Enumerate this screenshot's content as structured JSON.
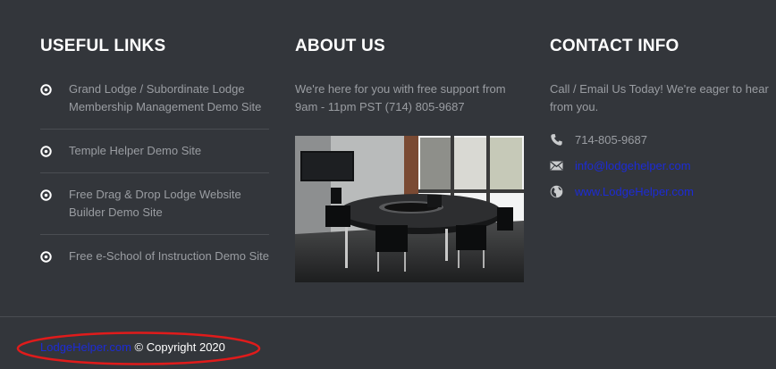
{
  "useful_links": {
    "heading": "USEFUL LINKS",
    "items": [
      {
        "label": "Grand Lodge / Subordinate Lodge Membership Management Demo Site"
      },
      {
        "label": "Temple Helper Demo Site"
      },
      {
        "label": "Free Drag & Drop Lodge Website Builder Demo Site"
      },
      {
        "label": "Free e-School of Instruction Demo Site"
      }
    ],
    "bullet_icon": "circle-dot-icon"
  },
  "about": {
    "heading": "ABOUT US",
    "text": "We're here for you with free support from 9am - 11pm PST (714) 805-9687",
    "photo": "conference-room-photo"
  },
  "contact": {
    "heading": "CONTACT INFO",
    "text": "Call / Email Us Today! We're eager to hear from you.",
    "phone": "714-805-9687",
    "email": "info@lodgehelper.com",
    "website": "www.LodgeHelper.com",
    "icons": {
      "phone": "phone-icon",
      "email": "envelope-icon",
      "website": "globe-icon"
    }
  },
  "bottom": {
    "site_link": "LodgeHelper.com",
    "copyright": "© Copyright 2020",
    "annotation": "red-ellipse-highlight"
  },
  "colors": {
    "background": "#33363b",
    "heading": "#ffffff",
    "body_text": "#9a9da2",
    "link": "#1c2bd6",
    "divider": "#4a4d52",
    "annotation": "#e01b1b"
  }
}
